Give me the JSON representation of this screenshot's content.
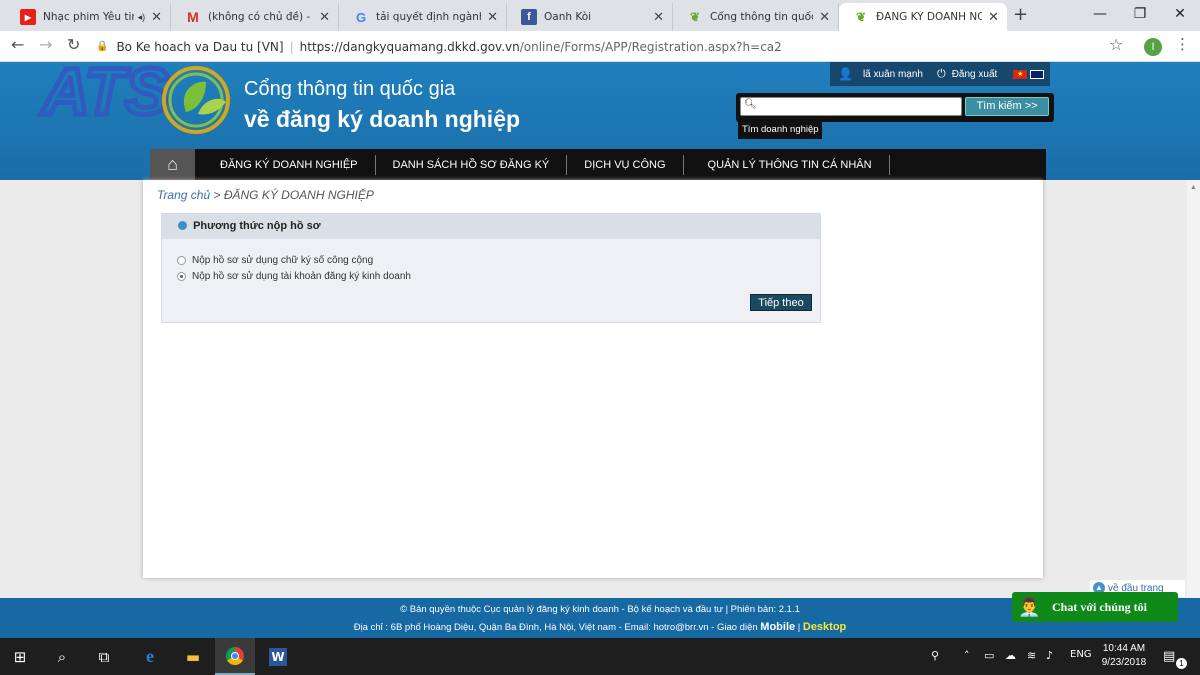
{
  "browser": {
    "tabs": [
      {
        "title": "Nhạc phim Yêu tinh",
        "icon": "youtube-icon",
        "audio": "◂)"
      },
      {
        "title": "(không có chủ đề) - kim",
        "icon": "gmail-icon"
      },
      {
        "title": "tải quyết định ngành ng",
        "icon": "google-icon"
      },
      {
        "title": "Oanh Kòi",
        "icon": "facebook-icon"
      },
      {
        "title": "Cổng thông tin quốc gi",
        "icon": "leaf-icon"
      },
      {
        "title": "ĐĂNG KÝ DOANH NGH",
        "icon": "leaf-icon"
      }
    ],
    "close_glyph": "✕",
    "new_tab_glyph": "+",
    "site_owner": "Bo Ke hoach va Dau tu [VN]",
    "url_main": "https://dangkyquamang.dkkd.gov.vn",
    "url_path": "/online/Forms/APP/Registration.aspx?h=ca2",
    "profile_initial": "I"
  },
  "header": {
    "logo_watermark": "ATS",
    "title_line1": "Cổng thông tin quốc gia",
    "title_line2": "về đăng ký doanh nghiệp",
    "user_name": "lã xuân mạnh",
    "logout": "Đăng xuất",
    "search_button": "Tìm kiếm >>",
    "search_placeholder": "",
    "search_link": "Tìm doanh nghiệp"
  },
  "nav": {
    "items": [
      "ĐĂNG KÝ DOANH NGHIỆP",
      "DANH SÁCH HỒ SƠ ĐĂNG KÝ",
      "DỊCH VỤ CÔNG",
      "QUẢN LÝ THÔNG TIN CÁ NHÂN"
    ]
  },
  "breadcrumb": {
    "home": "Trang chủ",
    "separator": " > ",
    "current": "ĐĂNG KÝ DOANH NGHIỆP"
  },
  "panel": {
    "title": "Phương thức nộp hồ sơ",
    "options": [
      {
        "label": "Nộp hồ sơ sử dụng chữ ký số công cộng",
        "selected": false
      },
      {
        "label": "Nộp hồ sơ sử dụng tài khoản đăng ký kinh doanh",
        "selected": true
      }
    ],
    "next_button": "Tiếp theo"
  },
  "footer": {
    "line1": "© Bản quyền thuộc Cục quản lý đăng ký kinh doanh - Bộ kế hoạch và đầu tư | Phiên bản: 2.1.1",
    "line2_prefix": "Địa chỉ : 6B phố Hoàng Diệu, Quận Ba Đình, Hà Nội, Việt nam - Email: ",
    "email": "hotro@brr.vn",
    "line2_mid": " - Giao diện ",
    "mobile": "Mobile",
    "sep": " | ",
    "desktop": "Desktop",
    "to_top": "về đầu trang",
    "chat": "Chat với chúng tôi"
  },
  "taskbar": {
    "language": "ENG",
    "time": "10:44 AM",
    "date": "9/23/2018",
    "notification_count": "1"
  },
  "colors": {
    "header_blue": "#1b6ea8",
    "nav_black": "#111111",
    "next_button": "#1b4a5e",
    "chat_green": "#0f8a1a",
    "desktop_yellow": "#f2ea3c"
  }
}
